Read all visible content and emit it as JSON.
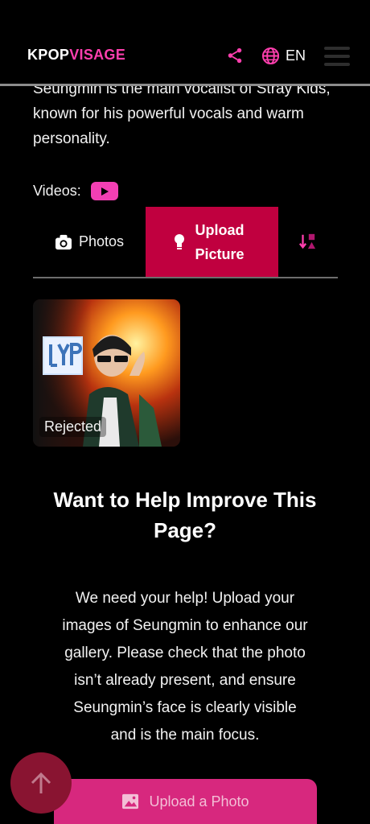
{
  "header": {
    "logo_part1": "KPOP",
    "logo_part2": "VISAGE",
    "language": "EN",
    "share_icon": "share-icon",
    "globe_icon": "globe-icon",
    "menu_icon": "hamburger-menu-icon"
  },
  "bio": {
    "line1": "Seungmin is the main vocalist of Stray Kids,",
    "line2": "known for his powerful vocals and warm",
    "line3": "personality."
  },
  "videos": {
    "label": "Videos:",
    "icon": "youtube-play-icon"
  },
  "tabs": {
    "photos_label": "Photos",
    "upload_label_1": "Upload",
    "upload_label_2": "Picture",
    "active": "Upload Picture",
    "sort_icon": "sort-icon"
  },
  "photo_card": {
    "status": "Rejected"
  },
  "help": {
    "title_line1": "Want to Help Improve This",
    "title_line2": "Page?",
    "text_line1": "We need your help! Upload your",
    "text_line2": "images of Seungmin to enhance our",
    "text_line3": "gallery. Please check that the photo",
    "text_line4": "isn’t already present, and ensure",
    "text_line5": "Seungmin’s face is clearly visible",
    "text_line6": "and is the main focus."
  },
  "buttons": {
    "upload_photo": "Upload a Photo"
  },
  "colors": {
    "accent": "#ff3fae",
    "tab_active": "#c0003f",
    "upload_button": "#d7287e",
    "scroll_button": "#891431"
  }
}
